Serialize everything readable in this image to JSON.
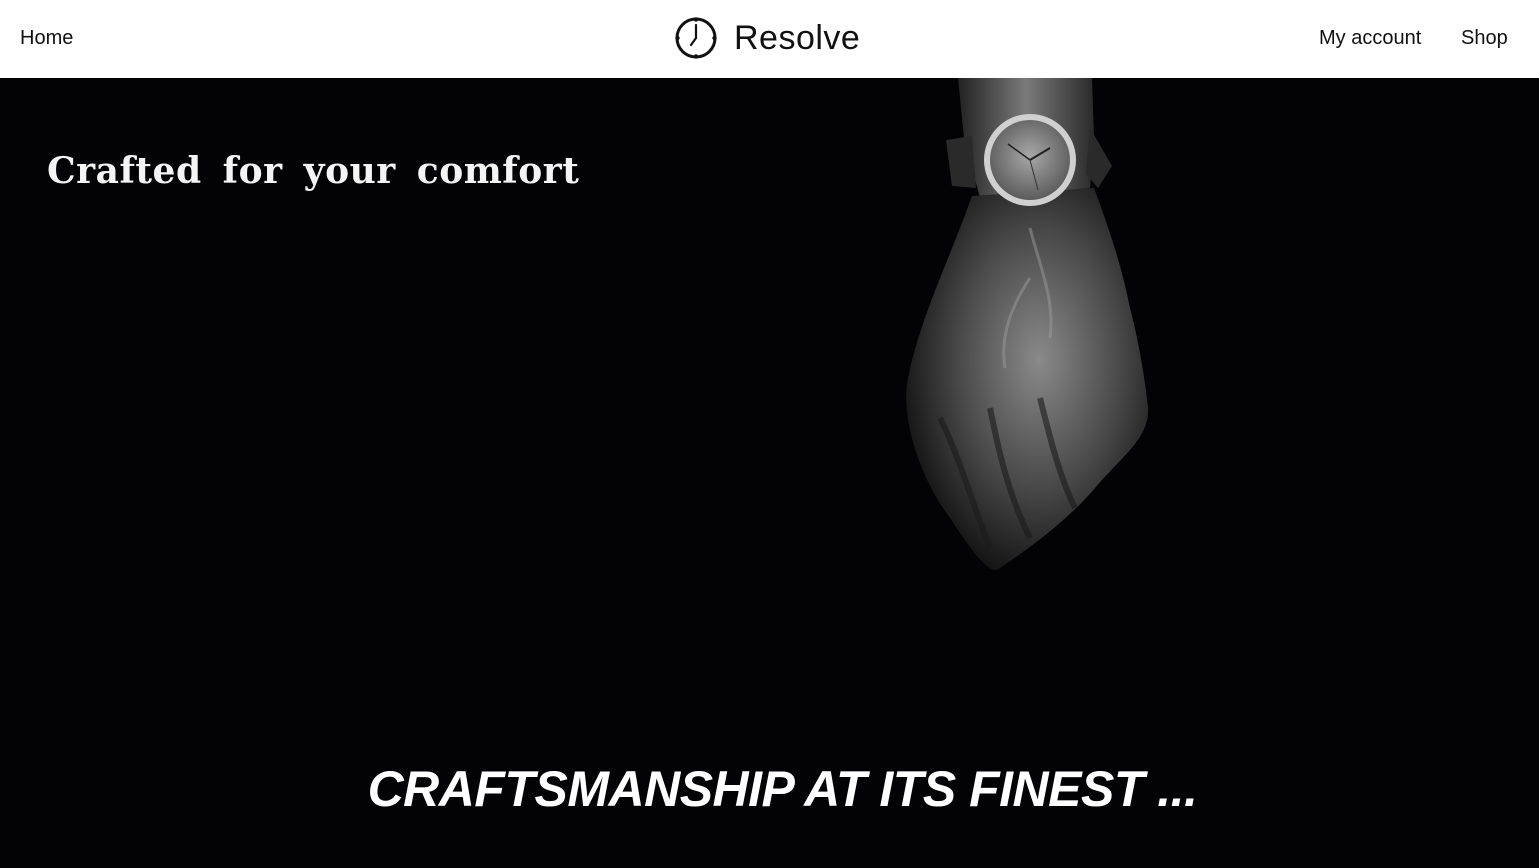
{
  "nav": {
    "home_label": "Home",
    "account_label": "My account",
    "shop_label": "Shop"
  },
  "brand": {
    "name": "Resolve",
    "icon": "clock-icon"
  },
  "hero": {
    "tagline": "Crafted for your comfort",
    "headline": "CRAFTSMANSHIP AT ITS FINEST ...",
    "image": "hand-wearing-wristwatch",
    "background_color": "#030305"
  }
}
